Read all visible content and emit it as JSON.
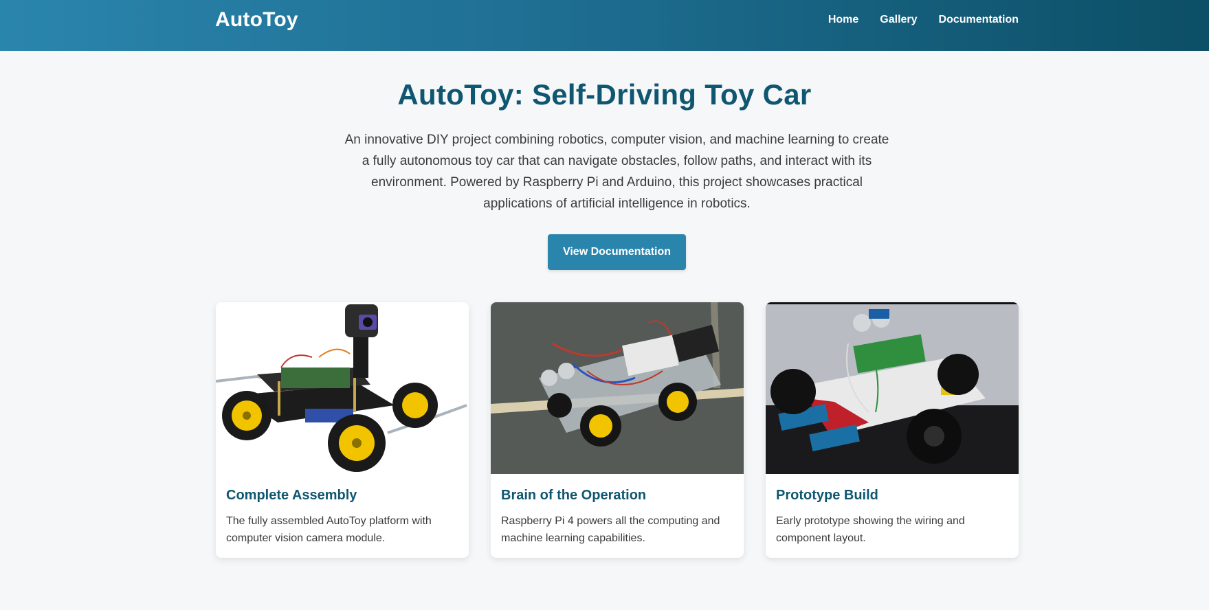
{
  "header": {
    "brand": "AutoToy",
    "nav": [
      {
        "label": "Home"
      },
      {
        "label": "Gallery"
      },
      {
        "label": "Documentation"
      }
    ]
  },
  "hero": {
    "title": "AutoToy: Self-Driving Toy Car",
    "description": "An innovative DIY project combining robotics, computer vision, and machine learning to create a fully autonomous toy car that can navigate obstacles, follow paths, and interact with its environment. Powered by Raspberry Pi and Arduino, this project showcases practical applications of artificial intelligence in robotics.",
    "cta_label": "View Documentation"
  },
  "cards": [
    {
      "title": "Complete Assembly",
      "description": "The fully assembled AutoToy platform with computer vision camera module.",
      "image": "robot-car-assembled-photo"
    },
    {
      "title": "Brain of the Operation",
      "description": "Raspberry Pi 4 powers all the computing and machine learning capabilities.",
      "image": "wired-robot-car-on-floor-photo"
    },
    {
      "title": "Prototype Build",
      "description": "Early prototype showing the wiring and component layout.",
      "image": "prototype-robot-with-ultrasonic-sensor-photo"
    }
  ],
  "colors": {
    "header_gradient_start": "#2a85ad",
    "header_gradient_end": "#0c4f66",
    "accent": "#2a85ad",
    "heading": "#0f5670",
    "page_background": "#f5f7f9"
  }
}
